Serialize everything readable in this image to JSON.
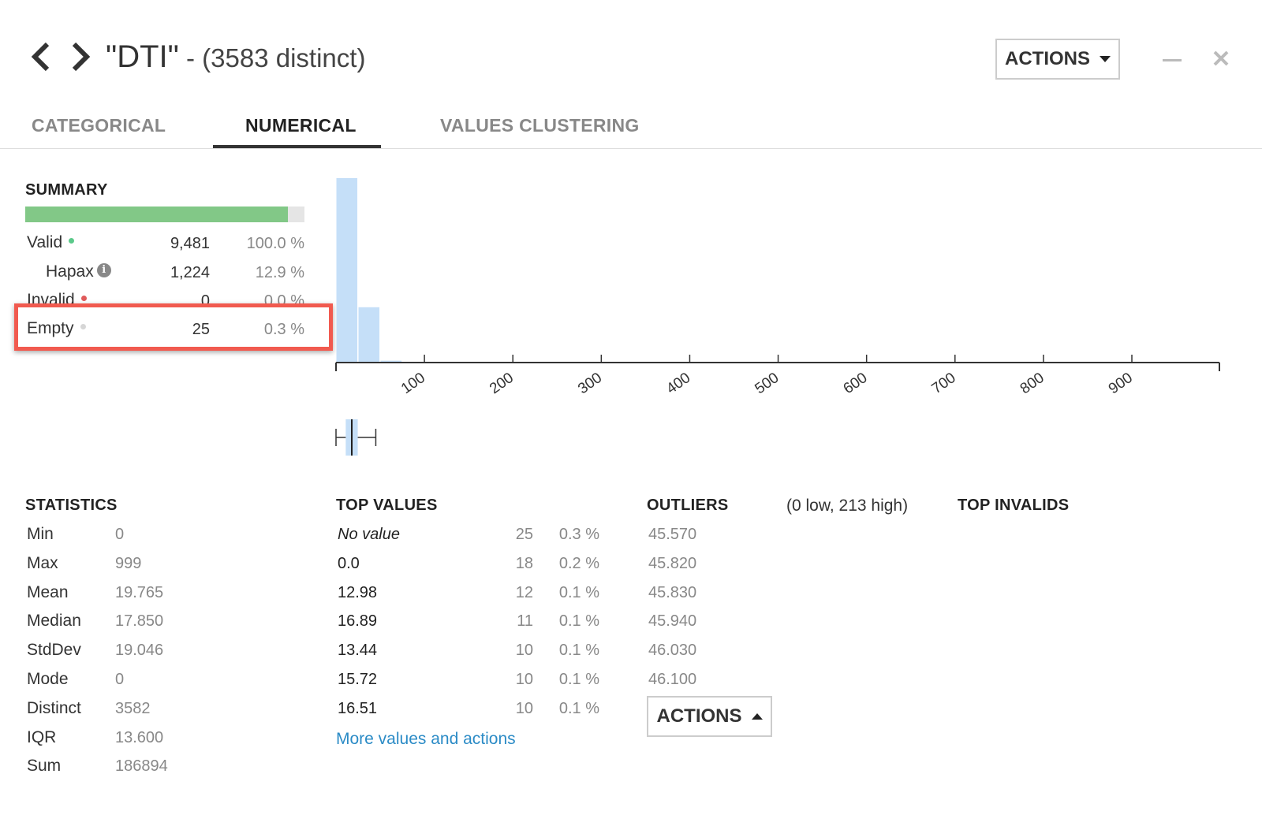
{
  "header": {
    "title": "\"DTI\"",
    "subtitle": " - (3583 distinct)",
    "actions_label": "ACTIONS",
    "prev_icon": "chevron-left-icon",
    "next_icon": "chevron-right-icon",
    "minimize_icon": "minimize-icon",
    "close_icon": "close-icon"
  },
  "tabs": [
    {
      "label": "CATEGORICAL",
      "active": false
    },
    {
      "label": "NUMERICAL",
      "active": true
    },
    {
      "label": "VALUES CLUSTERING",
      "active": false
    }
  ],
  "summary": {
    "title": "SUMMARY",
    "valid_fraction": 0.94,
    "rows": [
      {
        "label": "Valid",
        "count": "9,481",
        "pct": "100.0 %",
        "dot_color": "#5bc98a"
      },
      {
        "label": "Hapax",
        "count": "1,224",
        "pct": "12.9 %"
      },
      {
        "label": "Invalid",
        "count": "0",
        "pct": "0.0 %",
        "dot_color": "#e05a5a"
      },
      {
        "label": "Empty",
        "count": "25",
        "pct": "0.3 %",
        "dot_color": "#d6d6d6"
      }
    ]
  },
  "chart_data": {
    "type": "bar",
    "title": "",
    "xlabel": "",
    "ylabel": "",
    "x_ticks": [
      "100",
      "200",
      "300",
      "400",
      "500",
      "600",
      "700",
      "800",
      "900"
    ],
    "xlim": [
      0,
      999
    ],
    "bins": [
      {
        "start": 0,
        "end": 25,
        "rel_height": 1.0
      },
      {
        "start": 25,
        "end": 50,
        "rel_height": 0.3
      },
      {
        "start": 50,
        "end": 75,
        "rel_height": 0.01
      }
    ],
    "bar_color": "#c5dff8",
    "boxplot": {
      "min": 0,
      "q1": 11,
      "median": 17.85,
      "q3": 24.6,
      "whisker_high": 45
    }
  },
  "statistics": {
    "title": "STATISTICS",
    "rows": [
      {
        "label": "Min",
        "value": "0"
      },
      {
        "label": "Max",
        "value": "999"
      },
      {
        "label": "Mean",
        "value": "19.765"
      },
      {
        "label": "Median",
        "value": "17.850"
      },
      {
        "label": "StdDev",
        "value": "19.046"
      },
      {
        "label": "Mode",
        "value": "0"
      },
      {
        "label": "Distinct",
        "value": "3582"
      },
      {
        "label": "IQR",
        "value": "13.600"
      },
      {
        "label": "Sum",
        "value": "186894"
      }
    ]
  },
  "top_values": {
    "title": "TOP VALUES",
    "rows": [
      {
        "value": "No value",
        "count": "25",
        "pct": "0.3 %",
        "italic": true
      },
      {
        "value": "0.0",
        "count": "18",
        "pct": "0.2 %"
      },
      {
        "value": "12.98",
        "count": "12",
        "pct": "0.1 %"
      },
      {
        "value": "16.89",
        "count": "11",
        "pct": "0.1 %"
      },
      {
        "value": "13.44",
        "count": "10",
        "pct": "0.1 %"
      },
      {
        "value": "15.72",
        "count": "10",
        "pct": "0.1 %"
      },
      {
        "value": "16.51",
        "count": "10",
        "pct": "0.1 %"
      }
    ],
    "more_link": "More values and actions"
  },
  "outliers": {
    "title": "OUTLIERS",
    "summary": "(0 low, 213 high)",
    "values": [
      "45.570",
      "45.820",
      "45.830",
      "45.940",
      "46.030",
      "46.100"
    ],
    "actions_label": "ACTIONS"
  },
  "top_invalids": {
    "title": "TOP INVALIDS"
  }
}
